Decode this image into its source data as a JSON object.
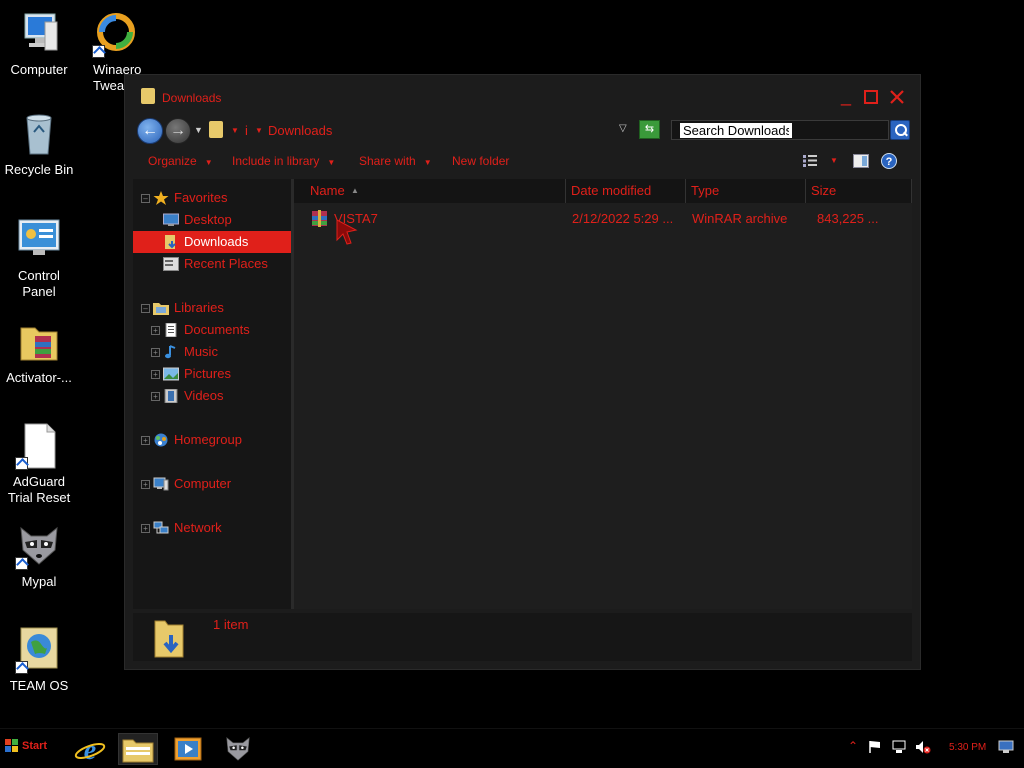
{
  "desktop": {
    "icons": [
      {
        "label": "Computer"
      },
      {
        "label": "Winaero Twea"
      },
      {
        "label": "Recycle Bin"
      },
      {
        "label": "Control Panel"
      },
      {
        "label": "Activator-..."
      },
      {
        "label": "AdGuard Trial Reset"
      },
      {
        "label": "Mypal"
      },
      {
        "label": "TEAM OS"
      }
    ]
  },
  "window": {
    "title": "Downloads",
    "address": {
      "root_crumb": "i",
      "current_crumb": "Downloads",
      "search_placeholder": "Search Downloads"
    },
    "commands": {
      "organize": "Organize",
      "include_in_library": "Include in library",
      "share_with": "Share with",
      "new_folder": "New folder"
    },
    "nav": {
      "favorites": "Favorites",
      "desktop": "Desktop",
      "downloads": "Downloads",
      "recent_places": "Recent Places",
      "libraries": "Libraries",
      "documents": "Documents",
      "music": "Music",
      "pictures": "Pictures",
      "videos": "Videos",
      "homegroup": "Homegroup",
      "computer": "Computer",
      "network": "Network"
    },
    "columns": {
      "name": "Name",
      "date_modified": "Date modified",
      "type": "Type",
      "size": "Size"
    },
    "files": [
      {
        "name": "VISTA7",
        "date_modified": "2/12/2022 5:29 ...",
        "type": "WinRAR archive",
        "size": "843,225 ..."
      }
    ],
    "details": {
      "count": "1 item"
    }
  },
  "taskbar": {
    "start_label": "Start",
    "clock": "5:30 PM"
  },
  "colors": {
    "accent": "#e0201a",
    "window_bg": "#1c1c1c",
    "desktop_bg": "#000000"
  }
}
